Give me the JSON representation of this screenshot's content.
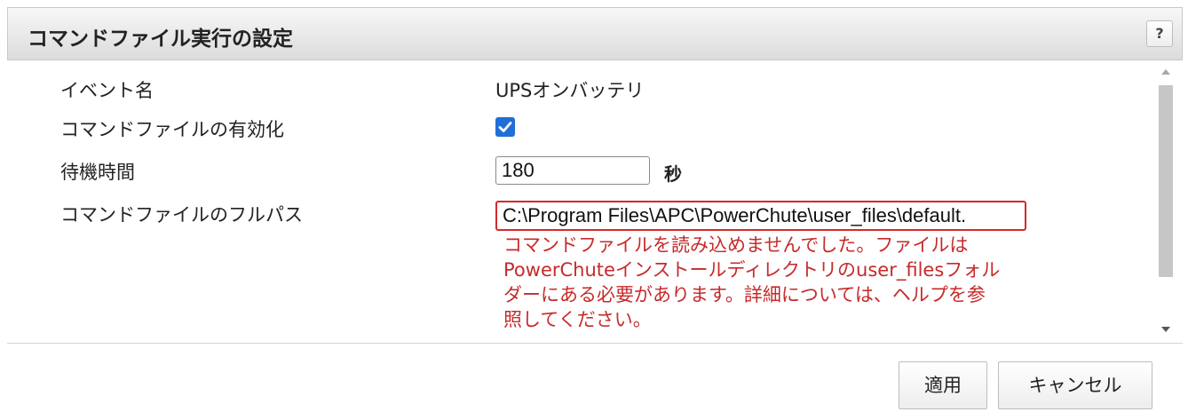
{
  "dialog": {
    "title": "コマンドファイル実行の設定",
    "help_label": "?"
  },
  "fields": {
    "event_name_label": "イベント名",
    "event_name_value": "UPSオンバッテリ",
    "enable_label": "コマンドファイルの有効化",
    "enable_checked": true,
    "wait_label": "待機時間",
    "wait_value": "180",
    "wait_unit": "秒",
    "path_label": "コマンドファイルのフルパス",
    "path_value": "C:\\Program Files\\APC\\PowerChute\\user_files\\default.",
    "error_lines": [
      "コマンドファイルを読み込めませんでした。ファイルは",
      "PowerChuteインストールディレクトリのuser_filesフォル",
      "ダーにある必要があります。詳細については、ヘルプを参",
      "照してください。"
    ]
  },
  "buttons": {
    "apply": "適用",
    "cancel": "キャンセル"
  },
  "colors": {
    "error": "#c72a2a",
    "checkbox": "#1f6fd6",
    "scroll_thumb": "#c6c6c6"
  },
  "icons": {
    "checkbox": "checkmark-icon",
    "scroll_up": "triangle-up-icon",
    "scroll_down": "triangle-down-icon"
  }
}
